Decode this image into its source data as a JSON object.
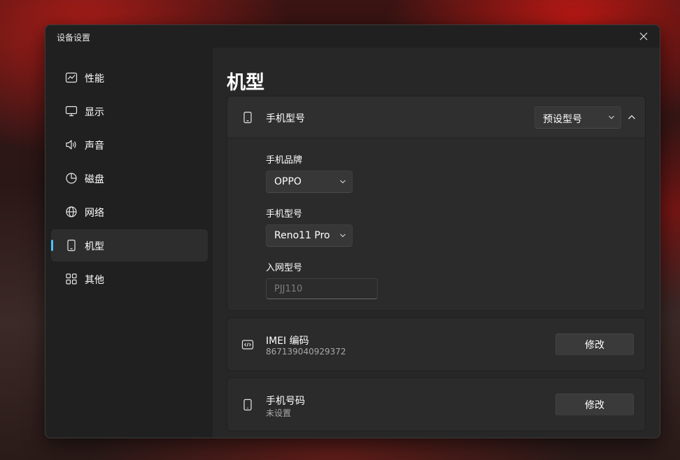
{
  "window": {
    "title": "设备设置"
  },
  "sidebar": {
    "items": [
      {
        "label": "性能",
        "icon": "chart-line-icon"
      },
      {
        "label": "显示",
        "icon": "monitor-icon"
      },
      {
        "label": "声音",
        "icon": "speaker-icon"
      },
      {
        "label": "磁盘",
        "icon": "pie-chart-icon"
      },
      {
        "label": "网络",
        "icon": "globe-icon"
      },
      {
        "label": "机型",
        "icon": "phone-icon"
      },
      {
        "label": "其他",
        "icon": "apps-grid-icon"
      }
    ],
    "active_index": 5,
    "accent_color": "#4cc2ff"
  },
  "main": {
    "title": "机型",
    "model_card": {
      "label": "手机型号",
      "preset_dropdown": "预设型号",
      "expanded": true,
      "brand_label": "手机品牌",
      "brand_value": "OPPO",
      "model_label": "手机型号",
      "model_value": "Reno11 Pro",
      "network_model_label": "入网型号",
      "network_model_placeholder": "PJJ110"
    },
    "imei_card": {
      "label": "IMEI 编码",
      "value": "867139040929372",
      "button": "修改"
    },
    "phone_card": {
      "label": "手机号码",
      "value": "未设置",
      "button": "修改"
    }
  }
}
